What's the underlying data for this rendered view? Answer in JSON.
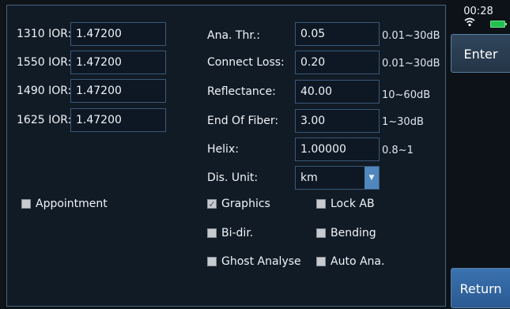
{
  "status": {
    "time": "00:28",
    "wifi_icon": "wifi-icon",
    "battery_icon": "battery-icon"
  },
  "sidebar": {
    "enter_label": "Enter",
    "return_label": "Return"
  },
  "ior": [
    {
      "label": "1310 IOR:",
      "value": "1.47200"
    },
    {
      "label": "1550 IOR:",
      "value": "1.47200"
    },
    {
      "label": "1490 IOR:",
      "value": "1.47200"
    },
    {
      "label": "1625 IOR:",
      "value": "1.47200"
    }
  ],
  "params": [
    {
      "label": "Ana. Thr.:",
      "value": "0.05",
      "range": "0.01~30dB"
    },
    {
      "label": "Connect Loss:",
      "value": "0.20",
      "range": "0.01~30dB"
    },
    {
      "label": "Reflectance:",
      "value": "40.00",
      "range": "10~60dB"
    },
    {
      "label": "End Of Fiber:",
      "value": "3.00",
      "range": "1~30dB"
    },
    {
      "label": "Helix:",
      "value": "1.00000",
      "range": "0.8~1"
    }
  ],
  "dis_unit": {
    "label": "Dis. Unit:",
    "value": "km"
  },
  "checkboxes": {
    "appointment": {
      "label": "Appointment",
      "checked": false
    },
    "graphics": {
      "label": "Graphics",
      "checked": true
    },
    "lock_ab": {
      "label": "Lock AB",
      "checked": false
    },
    "bi_dir": {
      "label": "Bi-dir.",
      "checked": false
    },
    "bending": {
      "label": "Bending",
      "checked": false
    },
    "ghost_analyse": {
      "label": "Ghost Analyse",
      "checked": false
    },
    "auto_ana": {
      "label": "Auto Ana.",
      "checked": false
    }
  },
  "colors": {
    "panel_border": "#46627d",
    "field_border": "#3b5875",
    "accent_blue": "#3a72b0",
    "battery_green": "#23c04f"
  }
}
